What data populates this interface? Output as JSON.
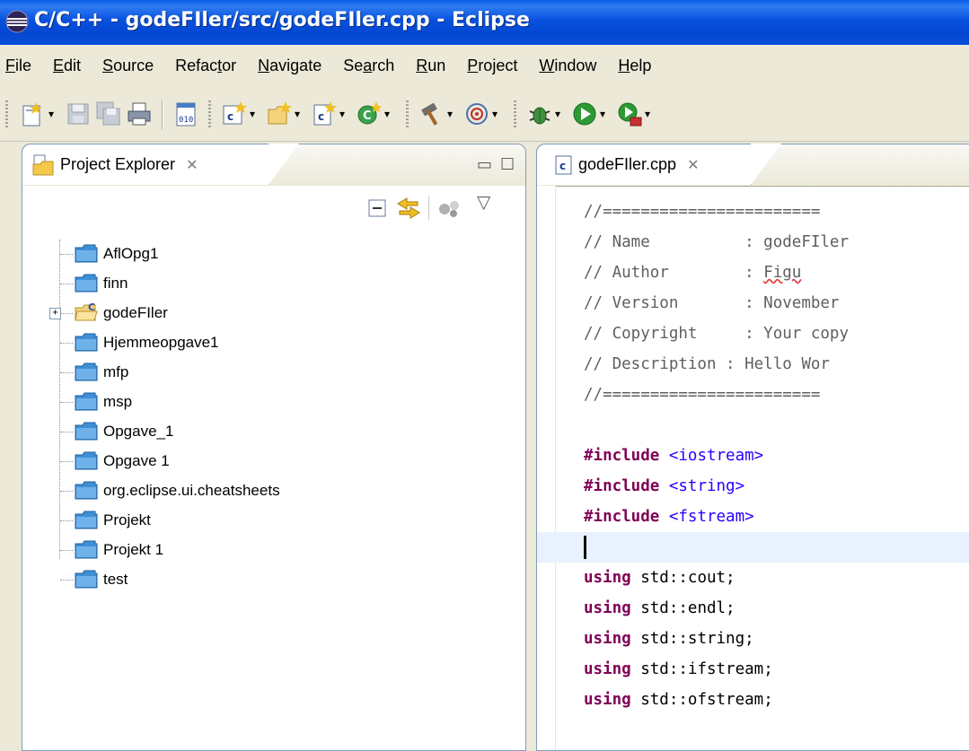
{
  "window": {
    "title": "C/C++ - godeFIler/src/godeFIler.cpp - Eclipse"
  },
  "menu": {
    "items": [
      {
        "pre": "",
        "mn": "F",
        "post": "ile"
      },
      {
        "pre": "",
        "mn": "E",
        "post": "dit"
      },
      {
        "pre": "",
        "mn": "S",
        "post": "ource"
      },
      {
        "pre": "Refac",
        "mn": "t",
        "post": "or"
      },
      {
        "pre": "",
        "mn": "N",
        "post": "avigate"
      },
      {
        "pre": "Se",
        "mn": "a",
        "post": "rch"
      },
      {
        "pre": "",
        "mn": "R",
        "post": "un"
      },
      {
        "pre": "",
        "mn": "P",
        "post": "roject"
      },
      {
        "pre": "",
        "mn": "W",
        "post": "indow"
      },
      {
        "pre": "",
        "mn": "H",
        "post": "elp"
      }
    ]
  },
  "project_explorer": {
    "tab_label": "Project Explorer",
    "items": [
      {
        "label": "AflOpg1"
      },
      {
        "label": "finn"
      },
      {
        "label": "godeFIler",
        "expandable": true
      },
      {
        "label": "Hjemmeopgave1"
      },
      {
        "label": "mfp"
      },
      {
        "label": "msp"
      },
      {
        "label": "Opgave_1"
      },
      {
        "label": "Opgave 1"
      },
      {
        "label": "org.eclipse.ui.cheatsheets"
      },
      {
        "label": "Projekt"
      },
      {
        "label": "Projekt 1"
      },
      {
        "label": "test"
      }
    ]
  },
  "editor": {
    "tab_label": "godeFIler.cpp",
    "lines": {
      "l0": "//=======================",
      "l1": "// Name          : godeFIler",
      "l2a": "// Author        : ",
      "l2b": "Figu",
      "l3": "// Version       : November",
      "l4": "// Copyright     : Your copy",
      "l5": "// Description : Hello Wor",
      "l6": "//=======================",
      "inc1_kw": "#include",
      "inc1_hdr": " <iostream>",
      "inc2_kw": "#include",
      "inc2_hdr": " <string>",
      "inc3_kw": "#include",
      "inc3_hdr": " <fstream>",
      "u1_kw": "using",
      "u1": " std::cout;",
      "u2_kw": "using",
      "u2": " std::endl;",
      "u3_kw": "using",
      "u3": " std::string;",
      "u4_kw": "using",
      "u4": " std::ifstream;",
      "u5_kw": "using",
      "u5": " std::ofstream;"
    }
  },
  "colors": {
    "titlebar": "#0a4fd9",
    "keyword": "#7f0055",
    "include_header": "#2a00ff",
    "comment": "#3f7f5f"
  }
}
